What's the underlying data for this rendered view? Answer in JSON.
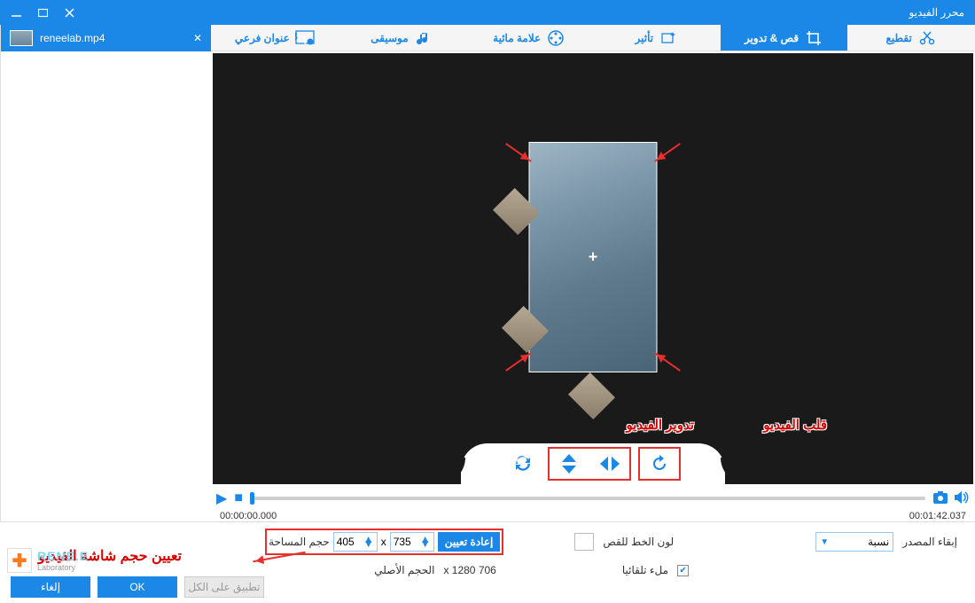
{
  "window": {
    "title": "محرر الفيديو"
  },
  "file": {
    "name": "reneelab.mp4"
  },
  "toolbar": {
    "cut": "تقطيع",
    "crop": "قص & تدوير",
    "effect": "تأثير",
    "watermark": "علامة مائية",
    "music": "موسيقى",
    "subtitle": "عنوان فرعي"
  },
  "annotations": {
    "rotate": "تدوير الفيديو",
    "flip": "قلب الفيديو",
    "setsize": "تعيين حجم شاشة الفيديو"
  },
  "playback": {
    "current": "00:00:00.000",
    "total": "00:01:42.037"
  },
  "panel": {
    "source_keep": "إبقاء المصدر",
    "ratio": "نسبة",
    "cut_color": "لون الخط للقص",
    "reset": "إعادة تعيين",
    "w": "735",
    "h": "405",
    "x": "x",
    "area_size": "حجم المساحة",
    "auto_fill": "ملء تلقائيا",
    "orig_size": "706 x 1280",
    "orig_label": "الحجم الأصلي"
  },
  "buttons": {
    "ok": "OK",
    "cancel": "إلغاء",
    "apply_all": "تطبيق على الكل"
  },
  "logo": {
    "name": "RENE.E",
    "sub": "Laboratory"
  }
}
